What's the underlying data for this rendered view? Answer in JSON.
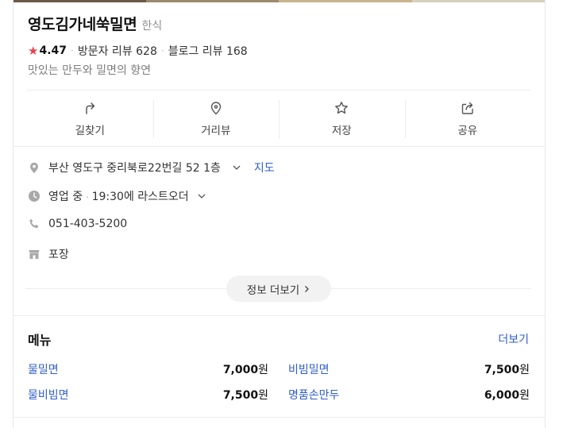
{
  "place": {
    "name": "영도김가네쑥밀면",
    "category": "한식",
    "rating": "4.47",
    "visitor_reviews": "방문자 리뷰 628",
    "blog_reviews": "블로그 리뷰 168",
    "description": "맛있는 만두와 밀면의 향연"
  },
  "actions": [
    {
      "label": "길찾기",
      "icon": "directions-icon"
    },
    {
      "label": "거리뷰",
      "icon": "location-pin-icon"
    },
    {
      "label": "저장",
      "icon": "star-outline-icon"
    },
    {
      "label": "공유",
      "icon": "share-icon"
    }
  ],
  "info": {
    "address": "부산 영도구 중리북로22번길 52 1층",
    "map_link": "지도",
    "status": "영업 중",
    "last_order": "19:30에 라스트오더",
    "phone": "051-403-5200",
    "service": "포장",
    "more_button": "정보 더보기"
  },
  "menu": {
    "title": "메뉴",
    "more": "더보기",
    "items": [
      {
        "name": "물밀면",
        "price": "7,000",
        "unit": "원"
      },
      {
        "name": "비빔밀면",
        "price": "7,500",
        "unit": "원"
      },
      {
        "name": "물비빔면",
        "price": "7,500",
        "unit": "원"
      },
      {
        "name": "명품손만두",
        "price": "6,000",
        "unit": "원"
      }
    ]
  },
  "colors": {
    "accent_link": "#2f5cc8",
    "star": "#e8424b",
    "icon_gray": "#a8a8a8"
  }
}
